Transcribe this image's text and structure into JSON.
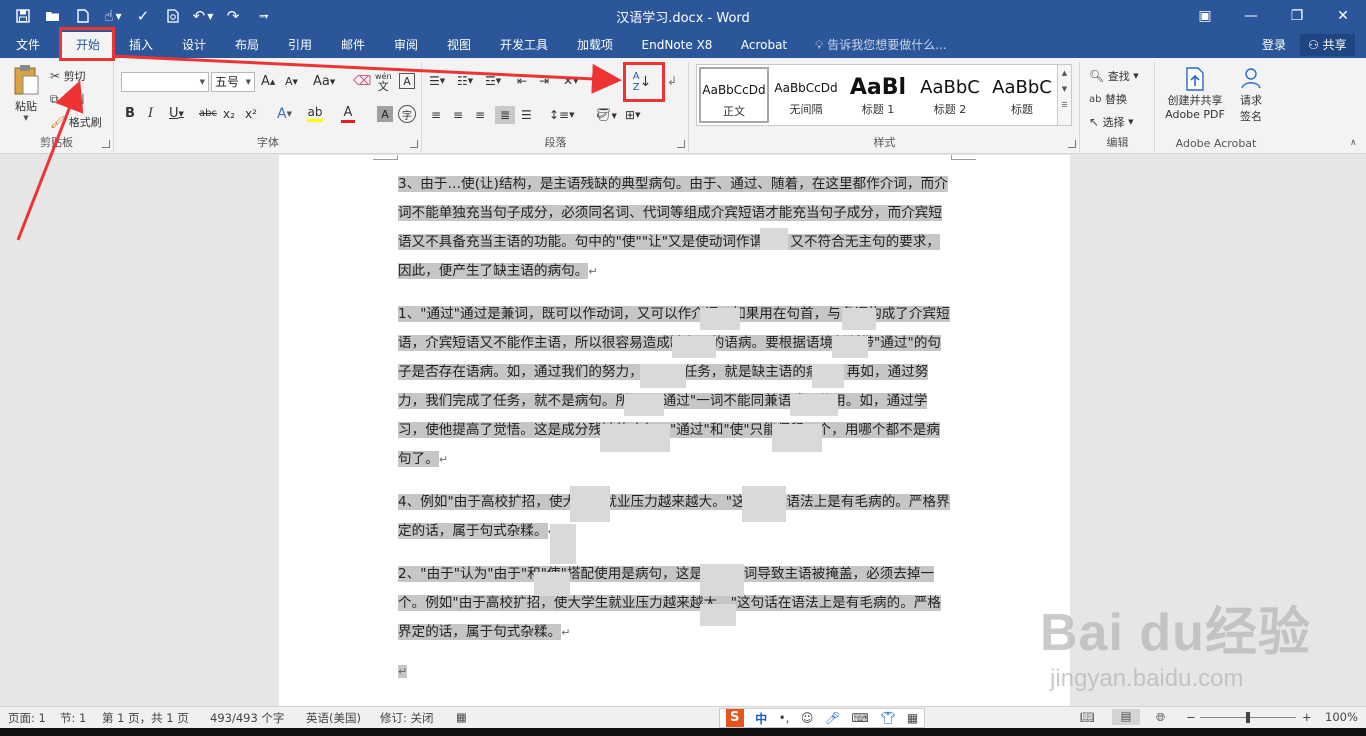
{
  "window": {
    "title": "汉语学习.docx - Word",
    "controls": [
      "ribbon-display-icon",
      "minimize-icon",
      "restore-icon",
      "close-icon"
    ]
  },
  "qat": {
    "icons": [
      "save-icon",
      "open-folder-icon",
      "new-document-icon",
      "touch-mode-icon",
      "spelling-icon",
      "print-preview-icon",
      "undo-icon",
      "redo-icon",
      "customize-qat-icon"
    ]
  },
  "tabs": [
    "文件",
    "开始",
    "插入",
    "设计",
    "布局",
    "引用",
    "邮件",
    "审阅",
    "视图",
    "开发工具",
    "加载项",
    "EndNote X8",
    "Acrobat"
  ],
  "active_tab": "开始",
  "tell_me": "告诉我您想要做什么...",
  "login": "登录",
  "share": "共享",
  "ribbon": {
    "clipboard": {
      "label": "剪贴板",
      "paste": "粘贴",
      "cut": "剪切",
      "copy": "复制",
      "format_painter": "格式刷"
    },
    "font": {
      "label": "字体",
      "font_name": "",
      "font_size": "五号",
      "bold": "B",
      "italic": "I",
      "underline": "U",
      "strike": "abc",
      "subscript": "x₂",
      "superscript": "x²",
      "case": "Aa",
      "font_color": "A",
      "char_shading": "A",
      "enclose": "A",
      "phonetic": "wén",
      "grow": "A",
      "shrink": "A"
    },
    "paragraph": {
      "label": "段落",
      "sort": "A↓Z"
    },
    "styles": {
      "label": "样式",
      "items": [
        {
          "sample": "AaBbCcDd",
          "name": "正文"
        },
        {
          "sample": "AaBbCcDd",
          "name": "无间隔"
        },
        {
          "sample": "AaBl",
          "name": "标题 1"
        },
        {
          "sample": "AaBbC",
          "name": "标题 2"
        },
        {
          "sample": "AaBbC",
          "name": "标题"
        }
      ]
    },
    "editing": {
      "label": "编辑",
      "find": "查找",
      "replace": "替换",
      "select": "选择"
    },
    "acrobat": {
      "label": "Adobe Acrobat",
      "create_pdf_line1": "创建并共享",
      "create_pdf_line2": "Adobe PDF",
      "sign_line1": "请求",
      "sign_line2": "签名"
    }
  },
  "document": {
    "paragraphs": [
      "3、由于…使(让)结构，是主语残缺的典型病句。由于、通过、随着，在这里都作介词，而介词不能单独充当句子成分，必须同名词、代词等组成介宾短语才能充当句子成分，而介宾短语又不具备充当主语的功能。句中的\"使\"\"让\"又是使动词作谓语，又不符合无主句的要求，因此，便产生了缺主语的病句。",
      "1、\"通过\"通过是兼词，既可以作动词，又可以作介词。如果用在句首，与名词构成了介宾短语，介宾短语又不能作主语，所以很容易造成缺主语的语病。要根据语境判断带\"通过\"的句子是否存在语病。如，通过我们的努力，完成了任务，就是缺主语的病句。再如，通过努力，我们完成了任务，就不是病句。所以，\"通过\"一词不能同兼语式配使用。如，通过学习，使他提高了觉悟。这是成分残缺的病句。\"通过\"和\"使\"只能保留一个，用哪个都不是病句了。",
      "4、例如\"由于高校扩招，使大学生就业压力越来越大。\"这句话在语法上是有毛病的。严格界定的话，属于句式杂糅。",
      "2、\"由于\"认为\"由于\"和\"使\"搭配使用是病句，这是因为介词导致主语被掩盖，必须去掉一个。例如\"由于高校扩招，使大学生就业压力越来越大。\"这句话在语法上是有毛病的。严格界定的话，属于句式杂糅。"
    ],
    "paragraph_mark": "↵"
  },
  "statusbar": {
    "page": "页面: 1",
    "section": "节: 1",
    "page_of": "第 1 页，共 1 页",
    "words": "493/493 个字",
    "language": "英语(美国)",
    "track_changes": "修订: 关闭",
    "zoom": "100%",
    "ime_logo": "S",
    "ime_mode": "中"
  },
  "watermark": {
    "main": "Bai du经验",
    "sub": "jingyan.baidu.com"
  },
  "colors": {
    "accent": "#2b579a",
    "annotation": "#ee3333",
    "selection": "#c6c6c6"
  }
}
